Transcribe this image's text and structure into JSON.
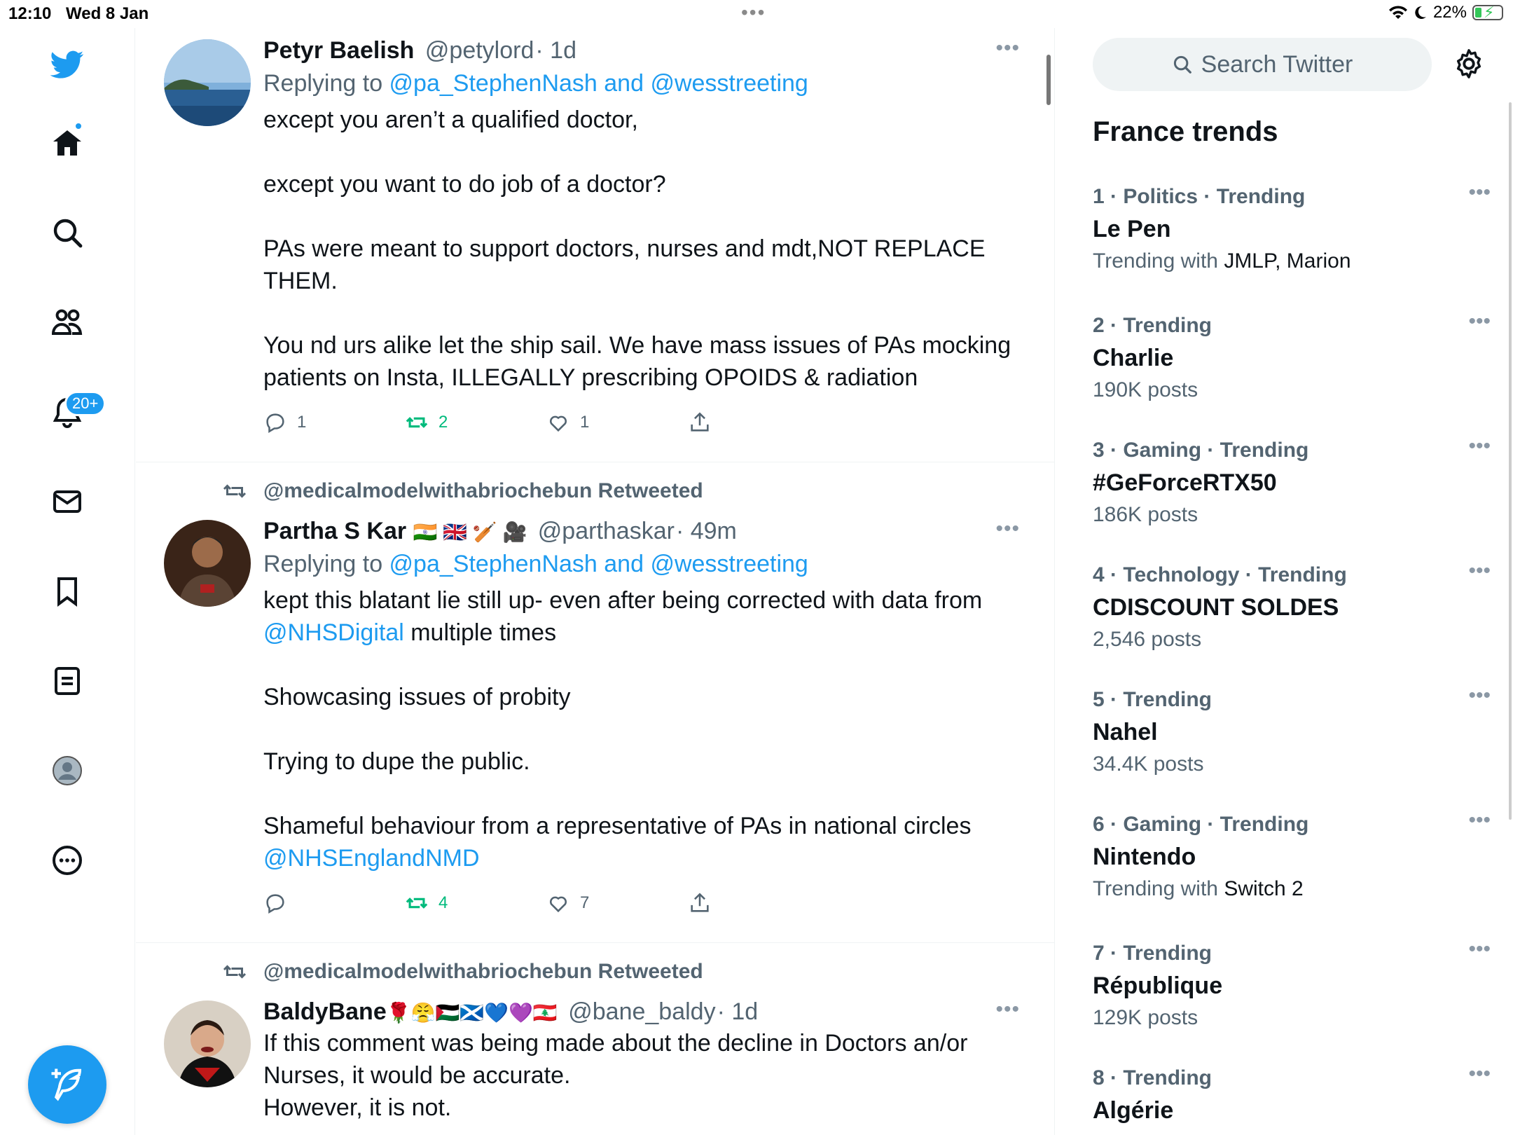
{
  "status": {
    "time": "12:10",
    "date": "Wed 8 Jan",
    "battery": "22%"
  },
  "rail": {
    "notifications_badge": "20+"
  },
  "tweets": [
    {
      "name": "Petyr Baelish",
      "handle": "@petylord",
      "time": "· 1d",
      "replying_prefix": "Replying to ",
      "replying_to": "@pa_StephenNash and @wesstreeting",
      "text": "except you aren’t a qualified doctor,\n\nexcept you want to do job of a doctor?\n\nPAs were meant to support doctors, nurses and mdt,NOT REPLACE THEM.\n\nYou nd urs alike let the ship sail. We have mass issues of PAs mocking patients on Insta, ILLEGALLY prescribing OPOIDS & radiation",
      "replies": "1",
      "retweets": "2",
      "likes": "1"
    },
    {
      "retweeted_by": "@medicalmodelwithabriochebun Retweeted",
      "name": "Partha S Kar",
      "emoji": "🇮🇳 🇬🇧 🏏 🎥",
      "handle": "@parthaskar",
      "time": "· 49m",
      "replying_prefix": "Replying to ",
      "replying_to": "@pa_StephenNash and @wesstreeting",
      "text_1": "kept this blatant lie still up- even after being corrected with data from",
      "mention_1": "@NHSDigital",
      "text_2": " multiple times\n\nShowcasing issues of probity\n\nTrying to dupe the public.\n\nShameful behaviour from a representative of PAs in national circles",
      "mention_2": "@NHSEnglandNMD",
      "replies": "",
      "retweets": "4",
      "likes": "7"
    },
    {
      "retweeted_by": "@medicalmodelwithabriochebun Retweeted",
      "name": "BaldyBane",
      "emoji": "🌹😤🇵🇸🏴󠁧󠁢󠁳󠁣󠁴󠁿💙💜🇱🇧",
      "handle": "@bane_baldy",
      "time": "· 1d",
      "text": "If this comment was being made about the decline in Doctors an/or Nurses, it would be accurate.\nHowever, it is not."
    }
  ],
  "sidebar": {
    "search_placeholder": "Search Twitter",
    "title": "France trends",
    "trends": [
      {
        "meta": "1 · Politics · Trending",
        "name": "Le Pen",
        "sub_prefix": "Trending with ",
        "sub_with": "JMLP, Marion"
      },
      {
        "meta": "2 · Trending",
        "name": "Charlie",
        "sub_prefix": "190K posts",
        "sub_with": ""
      },
      {
        "meta": "3 · Gaming · Trending",
        "name": "#GeForceRTX50",
        "sub_prefix": "186K posts",
        "sub_with": ""
      },
      {
        "meta": "4 · Technology · Trending",
        "name": "CDISCOUNT SOLDES",
        "sub_prefix": "2,546 posts",
        "sub_with": ""
      },
      {
        "meta": "5 · Trending",
        "name": "Nahel",
        "sub_prefix": "34.4K posts",
        "sub_with": ""
      },
      {
        "meta": "6 · Gaming · Trending",
        "name": "Nintendo",
        "sub_prefix": "Trending with ",
        "sub_with": "Switch 2"
      },
      {
        "meta": "7 · Trending",
        "name": "République",
        "sub_prefix": "129K posts",
        "sub_with": ""
      },
      {
        "meta": "8 · Trending",
        "name": "Algérie",
        "sub_prefix": "",
        "sub_with": ""
      }
    ]
  },
  "colors": {
    "accent": "#1d9bf0",
    "retweet": "#00ba7c",
    "secondary_text": "#536471"
  }
}
